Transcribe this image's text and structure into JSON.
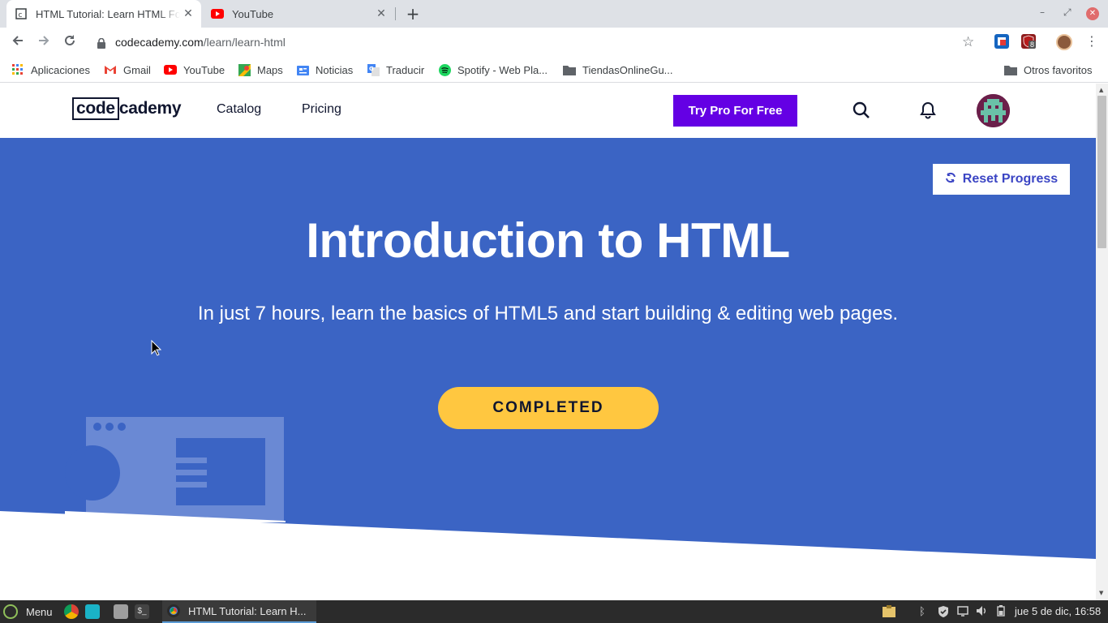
{
  "browser": {
    "tabs": [
      {
        "title": "HTML Tutorial: Learn HTML For Free | Codecademy",
        "active": true
      },
      {
        "title": "YouTube",
        "active": false
      }
    ],
    "url_host": "codecademy.com",
    "url_path": "/learn/learn-html",
    "extension_badge": "8",
    "bookmarks": [
      {
        "label": "Aplicaciones",
        "icon": "apps-grid-icon"
      },
      {
        "label": "Gmail",
        "icon": "gmail-icon"
      },
      {
        "label": "YouTube",
        "icon": "youtube-icon"
      },
      {
        "label": "Maps",
        "icon": "maps-icon"
      },
      {
        "label": "Noticias",
        "icon": "news-icon"
      },
      {
        "label": "Traducir",
        "icon": "translate-icon"
      },
      {
        "label": "Spotify - Web Pla...",
        "icon": "spotify-icon"
      },
      {
        "label": "TiendasOnlineGu...",
        "icon": "folder-icon"
      }
    ],
    "other_bookmarks": "Otros favoritos"
  },
  "site": {
    "logo_boxed": "code",
    "logo_rest": "cademy",
    "nav": {
      "catalog": "Catalog",
      "pricing": "Pricing"
    },
    "pro_button": "Try Pro For Free",
    "colors": {
      "pro": "#6400e4",
      "hero": "#3b64c4",
      "completed": "#ffc740"
    }
  },
  "hero": {
    "reset_button": "Reset Progress",
    "title": "Introduction to HTML",
    "subtitle": "In just 7 hours, learn the basics of HTML5 and start building & editing web pages.",
    "status_button": "COMPLETED"
  },
  "taskbar": {
    "menu_label": "Menu",
    "task_title": "HTML Tutorial: Learn H...",
    "clock": "jue  5 de dic, 16:58"
  }
}
